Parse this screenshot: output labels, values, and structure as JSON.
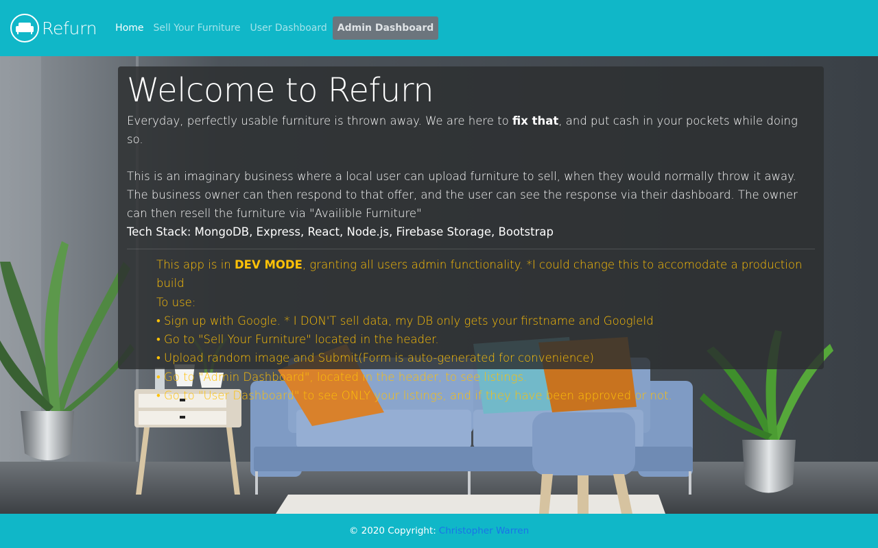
{
  "brand": {
    "name": "Refurn",
    "logo_icon": "sofa-icon"
  },
  "nav": {
    "home": "Home",
    "sell": "Sell Your Furniture",
    "user_dashboard": "User Dashboard",
    "admin_dashboard": "Admin Dashboard"
  },
  "jumbotron": {
    "title": "Welcome to Refurn",
    "intro_before": "Everyday, perfectly usable furniture is thrown away. We are here to ",
    "intro_bold": "fix that",
    "intro_after": ", and put cash in your pockets while doing so.",
    "description": "This is an imaginary business where a local user can upload furniture to sell, when they would normally throw it away. The business owner can then respond to that offer, and the user can see the response via their dashboard. The owner can then resell the furniture via \"Availible Furniture\"",
    "tech_stack": "Tech Stack: MongoDB, Express, React, Node.js, Firebase Storage, Bootstrap"
  },
  "dev_notice": {
    "before": "This app is in ",
    "bold": "DEV MODE",
    "after": ", granting all users admin functionality. *I could change this to accomodate a production build",
    "to_use": "To use:",
    "steps": [
      "• Sign up with Google. * I DON'T sell data, my DB only gets your firstname and GoogleId",
      "• Go to \"Sell Your Furniture\" located in the header.",
      "• Upload random image and Submit(Form is auto-generated for convenience)",
      "• Go to \"Admin Dashboard\", located in the header, to see listings.",
      "• Go to \"User Dashboard\" to see ONLY your listings, and if they have been approved or not."
    ]
  },
  "footer": {
    "copyright": "© 2020 Copyright:",
    "author": "Christopher Warren"
  },
  "colors": {
    "brand": "#10b7c8",
    "warning": "#ffc107",
    "admin_button": "#6c757d",
    "link": "#1a73e8"
  }
}
